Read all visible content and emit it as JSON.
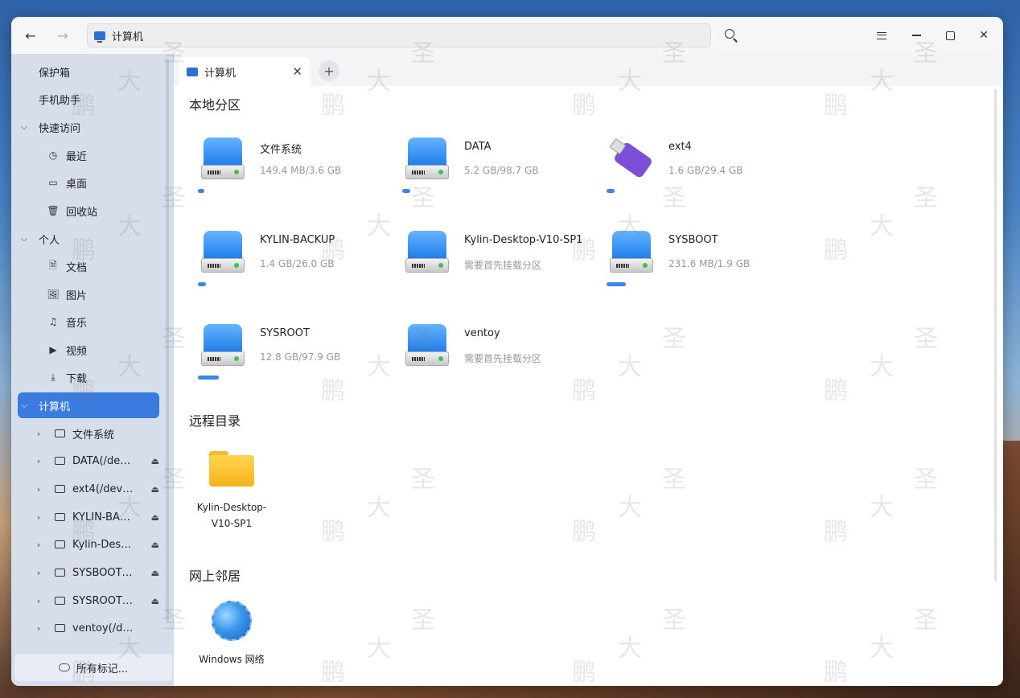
{
  "header": {
    "address": "计算机",
    "back_icon": "←",
    "forward_icon": "→",
    "close_icon": "✕"
  },
  "sidebar": {
    "items": [
      {
        "label": "保护箱"
      },
      {
        "label": "手机助手"
      },
      {
        "label": "快速访问",
        "chevron": "⌵"
      },
      {
        "label": "最近",
        "icon": "clock-icon",
        "glyph": "◷"
      },
      {
        "label": "桌面",
        "icon": "desktop-icon",
        "glyph": "▭"
      },
      {
        "label": "回收站",
        "icon": "trash-icon",
        "glyph": "🗑"
      },
      {
        "label": "个人",
        "chevron": "⌵"
      },
      {
        "label": "文档",
        "icon": "document-icon",
        "glyph": "🗎"
      },
      {
        "label": "图片",
        "icon": "picture-icon",
        "glyph": "🖼"
      },
      {
        "label": "音乐",
        "icon": "music-icon",
        "glyph": "♫"
      },
      {
        "label": "视频",
        "icon": "video-icon",
        "glyph": "▶"
      },
      {
        "label": "下载",
        "icon": "download-icon",
        "glyph": "⤓"
      },
      {
        "label": "计算机",
        "chevron": "⌵"
      },
      {
        "label": "文件系统",
        "chevron": "›"
      },
      {
        "label": "DATA(/de…",
        "chevron": "›",
        "eject": "⏏"
      },
      {
        "label": "ext4(/dev…",
        "chevron": "›",
        "eject": "⏏"
      },
      {
        "label": "KYLIN-BA…",
        "chevron": "›",
        "eject": "⏏"
      },
      {
        "label": "Kylin-Des…",
        "chevron": "›",
        "eject": "⏏"
      },
      {
        "label": "SYSBOOT…",
        "chevron": "›",
        "eject": "⏏"
      },
      {
        "label": "SYSROOT…",
        "chevron": "›",
        "eject": "⏏"
      },
      {
        "label": "ventoy(/d…",
        "chevron": "›"
      }
    ],
    "bottom_label": "所有标记..."
  },
  "tabs": {
    "active_label": "计算机",
    "close": "✕",
    "add": "+"
  },
  "content": {
    "local_title": "本地分区",
    "remote_title": "远程目录",
    "network_title": "网上邻居",
    "drives": [
      {
        "name": "文件系统",
        "size": "149.4 MB/3.6 GB",
        "usage": 0.04,
        "kind": "hdd"
      },
      {
        "name": "DATA",
        "size": "5.2 GB/98.7 GB",
        "usage": 0.05,
        "kind": "hdd"
      },
      {
        "name": "ext4",
        "size": "1.6 GB/29.4 GB",
        "usage": 0.05,
        "kind": "usb"
      },
      {
        "name": "KYLIN-BACKUP",
        "size": "1.4 GB/26.0 GB",
        "usage": 0.05,
        "kind": "hdd"
      },
      {
        "name": "Kylin-Desktop-V10-SP1",
        "size": "需要首先挂载分区",
        "usage": null,
        "kind": "hdd"
      },
      {
        "name": "SYSBOOT",
        "size": "231.6 MB/1.9 GB",
        "usage": 0.12,
        "kind": "hdd"
      },
      {
        "name": "SYSROOT",
        "size": "12.8 GB/97.9 GB",
        "usage": 0.13,
        "kind": "hdd"
      },
      {
        "name": "ventoy",
        "size": "需要首先挂载分区",
        "usage": null,
        "kind": "hdd"
      }
    ],
    "remote": [
      {
        "label_line1": "Kylin-Desktop-",
        "label_line2": "V10-SP1"
      }
    ],
    "network": [
      {
        "label": "Windows 网络"
      }
    ]
  },
  "watermark": [
    "大",
    "圣",
    "鹏"
  ]
}
